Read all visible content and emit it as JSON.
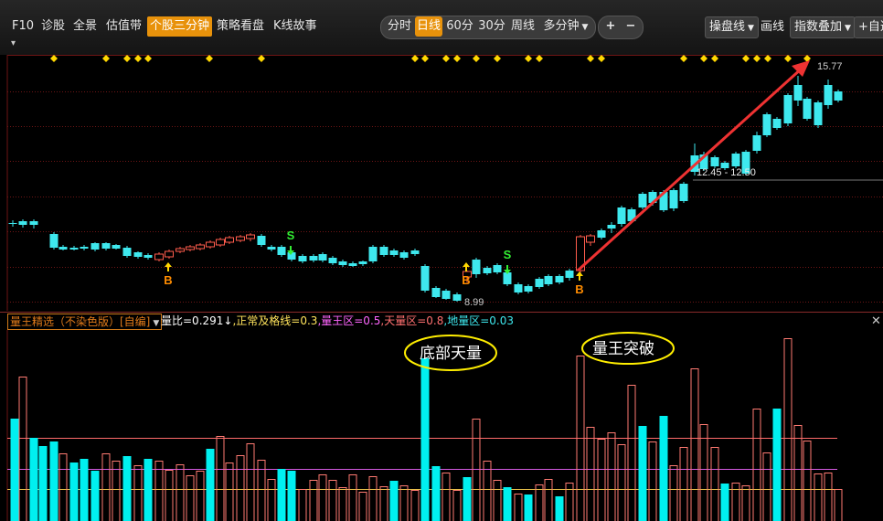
{
  "toolbar": {
    "left_tabs": [
      {
        "label": "F10",
        "active": false
      },
      {
        "label": "诊股",
        "active": false
      },
      {
        "label": "全景",
        "active": false
      },
      {
        "label": "估值带",
        "active": false
      },
      {
        "label": "个股三分钟",
        "active": true
      },
      {
        "label": "策略看盘",
        "active": false
      },
      {
        "label": "K线故事",
        "active": false
      }
    ],
    "periods": [
      {
        "label": "分时",
        "active": false
      },
      {
        "label": "日线",
        "active": true
      },
      {
        "label": "60分",
        "active": false
      },
      {
        "label": "30分",
        "active": false
      },
      {
        "label": "周线",
        "active": false
      },
      {
        "label": "多分钟",
        "active": false
      }
    ],
    "zoom_in": "+",
    "zoom_out": "−",
    "right_buttons": {
      "caopanxian": "操盘线",
      "huaxian": "画线",
      "zhishu_diejia": "指数叠加",
      "zixuan": "+自选"
    },
    "chevron_row": "▾"
  },
  "price_chart": {
    "high_label": "15.77",
    "low_label": "8.99",
    "range_label": "12.45 - 12.50",
    "buy_marker": "B",
    "sell_marker": "S",
    "colors": {
      "up": "#ff5c4d",
      "down": "#3ee8ee",
      "diamond": "#ffd700",
      "arrow": "#ee3232",
      "grid": "#6e1515"
    }
  },
  "indicator": {
    "name": "量王精选（不染色版）[自编]",
    "values": [
      {
        "text": "量比=0.291↓",
        "color": "#ffffff"
      },
      {
        "text": ",正常及格线=0.3",
        "color": "#ffe45c"
      },
      {
        "text": ",量王区=0.5",
        "color": "#ff66ff"
      },
      {
        "text": ",天量区=0.8",
        "color": "#ff7070"
      },
      {
        "text": ",地量区=0.03",
        "color": "#3ee8ee"
      }
    ],
    "close_icon": "✕"
  },
  "annotations": {
    "bottom_volume": "底部天量",
    "volume_breakout": "量王突破"
  }
}
